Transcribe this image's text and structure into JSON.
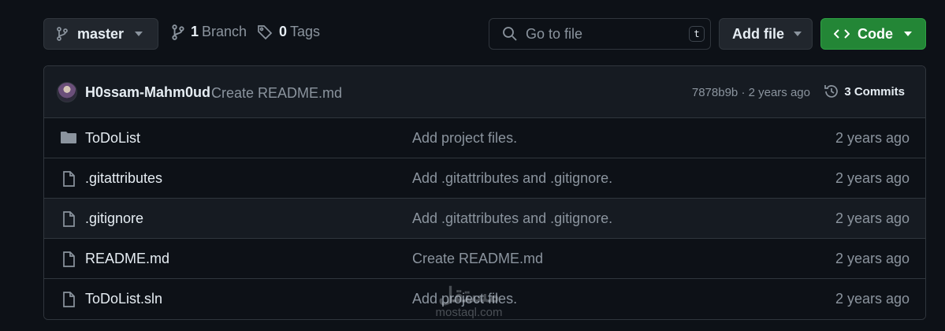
{
  "toolbar": {
    "branch_selector": "master",
    "branches_count": "1",
    "branches_label": "Branch",
    "tags_count": "0",
    "tags_label": "Tags",
    "search_placeholder": "Go to file",
    "search_shortcut": "t",
    "add_file_label": "Add file",
    "code_label": "Code"
  },
  "latest_commit": {
    "author": "H0ssam-Mahm0ud",
    "message": "Create README.md",
    "hash_and_time": "7878b9b · 2 years ago",
    "commits_count": "3 Commits"
  },
  "files": [
    {
      "type": "folder",
      "name": "ToDoList",
      "message": "Add project files.",
      "date": "2 years ago"
    },
    {
      "type": "file",
      "name": ".gitattributes",
      "message": "Add .gitattributes and .gitignore.",
      "date": "2 years ago"
    },
    {
      "type": "file",
      "name": ".gitignore",
      "message": "Add .gitattributes and .gitignore.",
      "date": "2 years ago"
    },
    {
      "type": "file",
      "name": "README.md",
      "message": "Create README.md",
      "date": "2 years ago"
    },
    {
      "type": "file",
      "name": "ToDoList.sln",
      "message": "Add project files.",
      "date": "2 years ago"
    }
  ],
  "watermark": {
    "arabic": "مستقل",
    "latin": "mostaql.com"
  },
  "colors": {
    "background": "#0d1117",
    "surface": "#161b22",
    "border": "#30363d",
    "button": "#21262d",
    "code_button": "#238636",
    "text": "#e6edf3",
    "muted": "#8b949e"
  }
}
